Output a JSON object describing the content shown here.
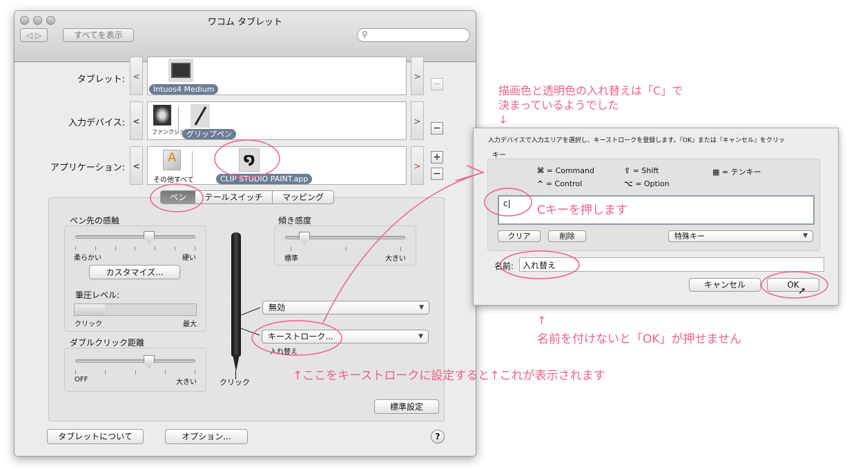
{
  "window": {
    "title": "ワコム タブレット",
    "show_all": "すべてを表示",
    "search_placeholder": ""
  },
  "rows": {
    "tablet": {
      "label": "タブレット:",
      "items": [
        {
          "name": "Intuos4 Medium"
        }
      ]
    },
    "input_device": {
      "label": "入力デバイス:",
      "items": [
        {
          "name": "ファンクション"
        },
        {
          "name": "グリップペン"
        }
      ]
    },
    "application": {
      "label": "アプリケーション:",
      "items": [
        {
          "name": "その他すべて"
        },
        {
          "name": "CLIP STUDIO PAINT.app"
        }
      ]
    },
    "prev": "<",
    "next": ">",
    "plus": "+",
    "minus": "−"
  },
  "tabs": [
    {
      "label": "ペン",
      "selected": true
    },
    {
      "label": "テールスイッチ"
    },
    {
      "label": "マッピング"
    }
  ],
  "pen_tab": {
    "tip_feel": {
      "title": "ペン先の感触",
      "min": "柔らかい",
      "max": "硬い",
      "value_fraction": 0.5,
      "customize": "カスタマイズ...",
      "pressure_label": "筆圧レベル:",
      "pressure_min": "クリック",
      "pressure_max": "最大",
      "pressure_fraction": 0.25
    },
    "double_click": {
      "title": "ダブルクリック距離",
      "min": "OFF",
      "max": "大きい",
      "value_fraction": 0.5
    },
    "tilt": {
      "title": "傾き感度",
      "min": "標準",
      "max": "大きい",
      "value_fraction": 0.0
    },
    "upper_button": "無効",
    "lower_button": "キーストローク...",
    "lower_button_sub": "入れ替え",
    "tip_label": "クリック",
    "default_button": "標準設定"
  },
  "footer": {
    "about": "タブレットについて",
    "options": "オプション...",
    "help": "?"
  },
  "dialog": {
    "instruction": "入力デバイスで入力エリアを選択し、キーストロークを登録します。『OK』または『キャンセル』をクリッ",
    "key_label": "キー",
    "legend": [
      {
        "sym": "⌘",
        "text": "= Command"
      },
      {
        "sym": "⇧",
        "text": "= Shift"
      },
      {
        "sym": "▦",
        "text": "= テンキー"
      },
      {
        "sym": "^",
        "text": "= Control"
      },
      {
        "sym": "⌥",
        "text": "= Option"
      }
    ],
    "key_value": "c",
    "clear": "クリア",
    "delete": "削除",
    "special_keys": "特殊キー",
    "name_label": "名前:",
    "name_value": "入れ替え",
    "cancel": "キャンセル",
    "ok": "OK"
  },
  "annotations": {
    "top_line1": "描画色と透明色の入れ替えは「C」で",
    "top_line2": "決まっているようでした",
    "top_arrow": "↓",
    "press_c": "Cキーを押します",
    "ok_arrow": "↑",
    "ok_note": "名前を付けないと「OK」が押せません",
    "bottom_note": "↑ここをキーストロークに設定すると↑これが表示されます",
    "color": "#ef5f86"
  }
}
